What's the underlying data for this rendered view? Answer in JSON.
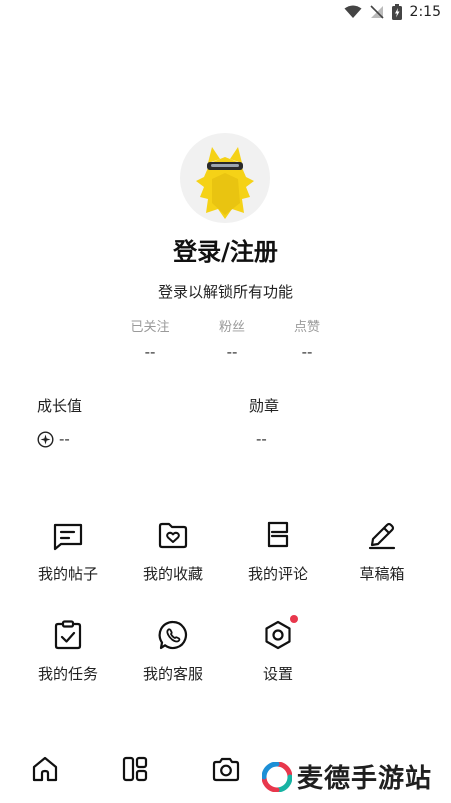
{
  "status_bar": {
    "time": "2:15"
  },
  "profile": {
    "login_title": "登录/注册",
    "login_subtitle": "登录以解锁所有功能"
  },
  "stats": [
    {
      "label": "已关注",
      "value": "--"
    },
    {
      "label": "粉丝",
      "value": "--"
    },
    {
      "label": "点赞",
      "value": "--"
    }
  ],
  "growth": {
    "title": "成长值",
    "value": "--"
  },
  "medals": {
    "title": "勋章",
    "value": "--"
  },
  "menu": [
    {
      "label": "我的帖子",
      "icon": "post-icon"
    },
    {
      "label": "我的收藏",
      "icon": "favorites-icon"
    },
    {
      "label": "我的评论",
      "icon": "comment-icon"
    },
    {
      "label": "草稿箱",
      "icon": "draft-icon"
    },
    {
      "label": "我的任务",
      "icon": "task-icon"
    },
    {
      "label": "我的客服",
      "icon": "customer-service-icon"
    },
    {
      "label": "设置",
      "icon": "settings-icon",
      "has_badge": true
    }
  ],
  "bottom_nav": [
    {
      "icon": "home-icon"
    },
    {
      "icon": "layout-icon"
    },
    {
      "icon": "camera-icon"
    }
  ],
  "watermark": {
    "text": "麦德手游站"
  },
  "colors": {
    "badge": "#e8374c",
    "avatar_bg": "#f1f1f1",
    "mascot": "#f5d217"
  }
}
